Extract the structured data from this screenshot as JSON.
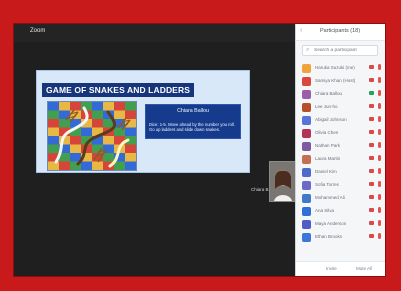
{
  "meeting": {
    "title": "Zoom"
  },
  "slide": {
    "title": "GAME OF SNAKES AND LADDERS",
    "box_name": "Chiara Ballou",
    "box_text": "Dice: 1-5. Move ahead by the number you roll. Go up ladders and slide down snakes."
  },
  "speaker": {
    "name": "Chiara B."
  },
  "participants": {
    "title": "Participants (18)",
    "search_placeholder": "Search a participant",
    "items": [
      {
        "name": "Haruka Suzuki (me)",
        "avatar_color": "#f0a33a"
      },
      {
        "name": "Samiya Khan (Host)",
        "avatar_color": "#d9473d"
      },
      {
        "name": "Chiara Ballou",
        "avatar_color": "#9c5da8"
      },
      {
        "name": "Lee Jun-ho",
        "avatar_color": "#b64f2b"
      },
      {
        "name": "Abigail Johnson",
        "avatar_color": "#5a73d8"
      },
      {
        "name": "Olivia Chen",
        "avatar_color": "#b13456"
      },
      {
        "name": "Nathan Park",
        "avatar_color": "#7e5aa5"
      },
      {
        "name": "Laura Martin",
        "avatar_color": "#c46f54"
      },
      {
        "name": "Daniel Kim",
        "avatar_color": "#4f6ac8"
      },
      {
        "name": "Sofia Torres",
        "avatar_color": "#6a68c8"
      },
      {
        "name": "Mohammed Ali",
        "avatar_color": "#3f79c9"
      },
      {
        "name": "Ana Silva",
        "avatar_color": "#2f6fd7"
      },
      {
        "name": "Maya Anderson",
        "avatar_color": "#4e5cc8"
      },
      {
        "name": "Ethan Brooks",
        "avatar_color": "#3b77d9"
      }
    ],
    "footer_left": "Invite",
    "footer_right": "Mute All"
  },
  "colors": {
    "outer_red": "#c81a1a",
    "slide_title": "#17357b",
    "info_box": "#163b8c",
    "meeting_bg": "#1f1f1f"
  }
}
